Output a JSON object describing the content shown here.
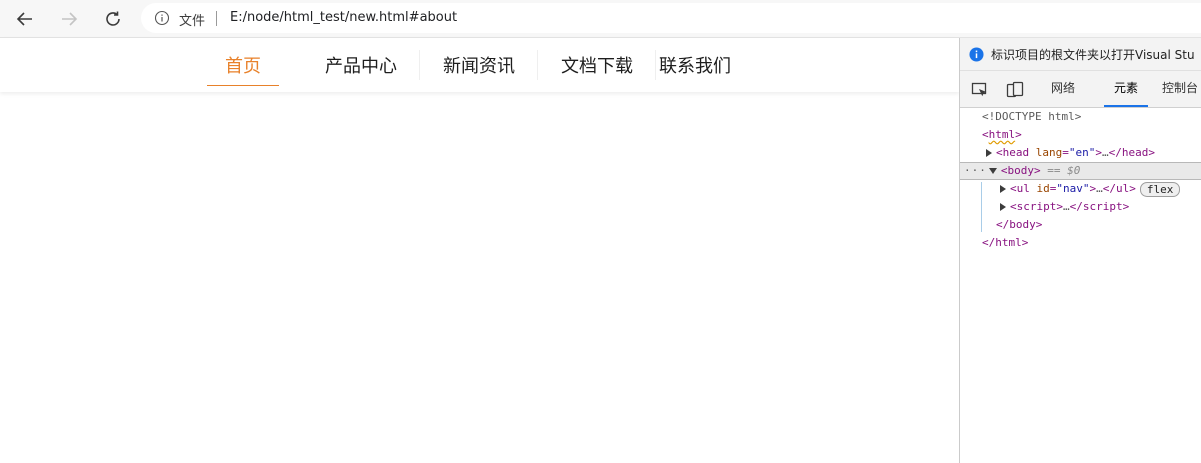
{
  "browser": {
    "file_label": "文件",
    "url": "E:/node/html_test/new.html#about"
  },
  "site_nav": {
    "items": [
      {
        "label": "首页",
        "active": true
      },
      {
        "label": "产品中心",
        "active": false
      },
      {
        "label": "新闻资讯",
        "active": false
      },
      {
        "label": "文档下载",
        "active": false
      },
      {
        "label": "联系我们",
        "active": false
      }
    ],
    "accent_color": "#e8812a"
  },
  "devtools": {
    "banner_text": "标识项目的根文件夹以打开Visual Stu",
    "tabs": [
      {
        "label": "网络",
        "active": false
      },
      {
        "label": "元素",
        "active": true
      },
      {
        "label": "控制台",
        "active": false
      }
    ],
    "dom": {
      "doctype": "<!DOCTYPE html>",
      "html_open": "html",
      "head_tag": "head",
      "head_attr_name": "lang",
      "head_attr_val": "\"en\"",
      "ellipsis": "…",
      "body_tag": "body",
      "body_marker": "== $0",
      "ul_tag": "ul",
      "ul_attr_name": "id",
      "ul_attr_val": "\"nav\"",
      "flex_badge": "flex",
      "script_tag": "script",
      "body_close": "</body>",
      "html_close": "</html>"
    }
  }
}
